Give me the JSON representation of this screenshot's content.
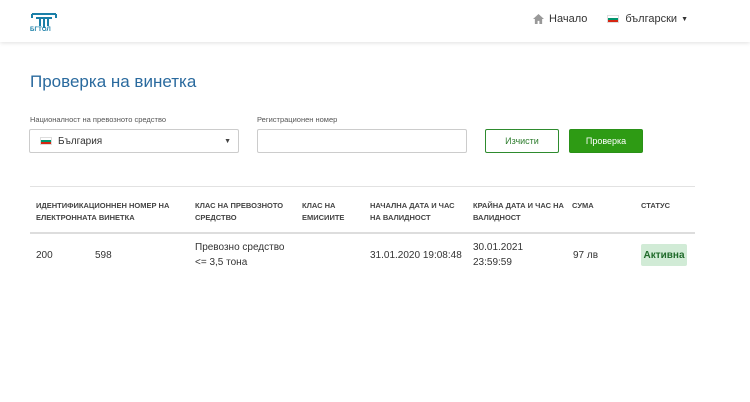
{
  "header": {
    "logo_text": "БГТОЛ",
    "nav_home": "Начало",
    "language": "български"
  },
  "page": {
    "title": "Проверка на винетка"
  },
  "form": {
    "nationality_label": "Националност на превозното средство",
    "nationality_value": "България",
    "registration_label": "Регистрационен номер",
    "registration_value": "",
    "clear_button": "Изчисти",
    "check_button": "Проверка"
  },
  "table": {
    "headers": [
      "Идентификационнен номер на електронната винетка",
      "Клас на превозното средство",
      "Клас на емисиите",
      "Начална дата и час на валидност",
      "Крайна дата и час на валидност",
      "Сума",
      "Статус"
    ],
    "rows": [
      {
        "id_part1": "200",
        "id_part2": "598",
        "vehicle_class": "Превозно средство <= 3,5 тона",
        "emission_class": "",
        "start": "31.01.2020 19:08:48",
        "end": "30.01.2021 23:59:59",
        "amount": "97 лв",
        "status": "Активна"
      }
    ]
  },
  "colors": {
    "brand": "#2a6a9e",
    "primary_button": "#2e9b14",
    "status_badge_bg": "#d1ebd6",
    "flag": [
      "#ffffff",
      "#00966e",
      "#d62612"
    ]
  }
}
